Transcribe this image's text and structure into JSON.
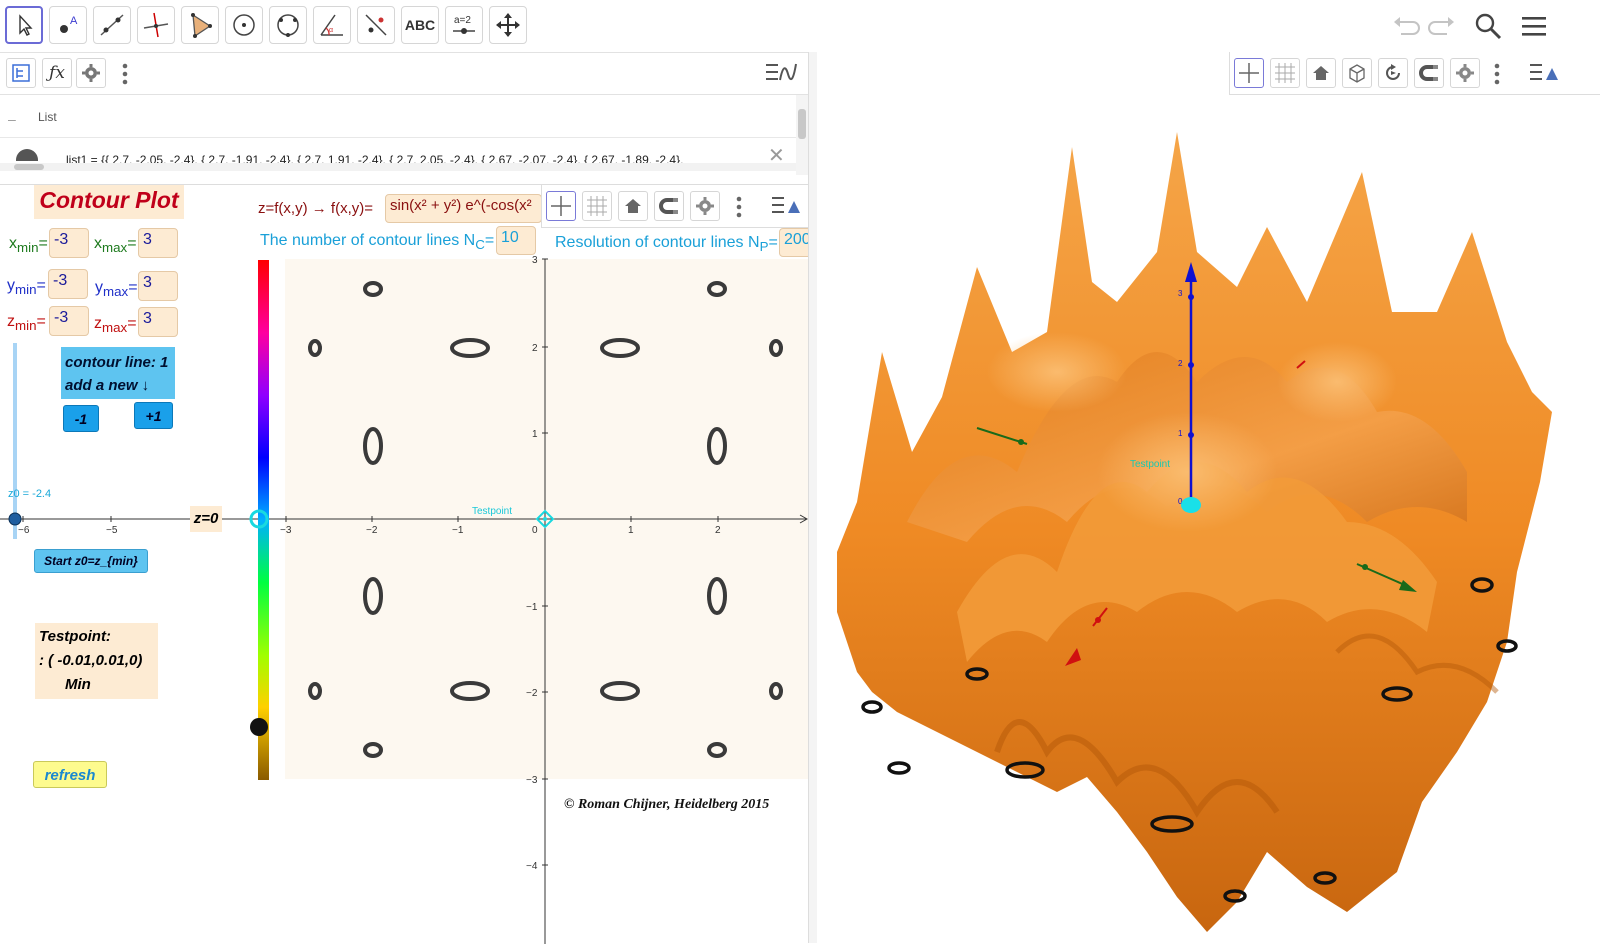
{
  "toolbar": {
    "text_tool_label": "ABC",
    "slider_tool_label": "a=2"
  },
  "algebra": {
    "group_label": "List",
    "list_item": "list1 = {{ 2.7, -2.05, -2.4}, { 2.7, -1.91, -2.4}, { 2.7, 1.91, -2.4}, { 2.7, 2.05, -2.4}, { 2.67, -2.07, -2.4}, { 2.67, -1.89, -2.4},"
  },
  "panel": {
    "title": "Contour Plot",
    "func_prefix": "z=f(x,y) →  f(x,y)=",
    "func_value": "sin(x² + y²) e^(-cos(x²",
    "nc_label": "The number of contour lines  N",
    "nc_sub": "C",
    "nc_value": "10",
    "np_label": "Resolution of contour lines  N",
    "np_sub": "P",
    "np_value": "200",
    "xmin_label": "x",
    "xmin_sub": "min",
    "xmin_value": "-3",
    "xmax_label": "x",
    "xmax_sub": "max",
    "xmax_value": "3",
    "ymin_label": "y",
    "ymin_sub": "min",
    "ymin_value": "-3",
    "ymax_label": "y",
    "ymax_sub": "max",
    "ymax_value": "3",
    "zmin_label": "z",
    "zmin_sub": "min",
    "zmin_value": "-3",
    "zmax_label": "z",
    "zmax_sub": "max",
    "zmax_value": "3",
    "contour_line_text": "contour line: 1",
    "add_new_text": "add a new   ↓",
    "minus_button": "-1",
    "plus_button": "+1",
    "slider_label": "z0 = -2.4",
    "z0_label": "z=0",
    "start_button": "Start z0=z_{min}",
    "testpoint_title": "Testpoint:",
    "testpoint_coords": ": ( -0.01,0.01,0)",
    "testpoint_type": "Min",
    "refresh_button": "refresh",
    "copyright": "©  Roman Chijner, Heidelberg 2015",
    "graph_testpoint_label": "Testpoint",
    "x_ticks_left": [
      "−6",
      "−5"
    ],
    "x_ticks": [
      "−3",
      "−2",
      "−1",
      "0",
      "1",
      "2"
    ],
    "y_ticks": [
      "3",
      "2",
      "1",
      "−1",
      "−2",
      "−3",
      "−4"
    ]
  },
  "view3d": {
    "testpoint_label": "Testpoint",
    "z_ticks": [
      "3",
      "2",
      "1",
      "0"
    ]
  },
  "colors": {
    "surface": "#f08a22",
    "accent_blue": "#1aa0ea",
    "field_bg": "#fdebd3",
    "contour_title": "#c0001a"
  }
}
